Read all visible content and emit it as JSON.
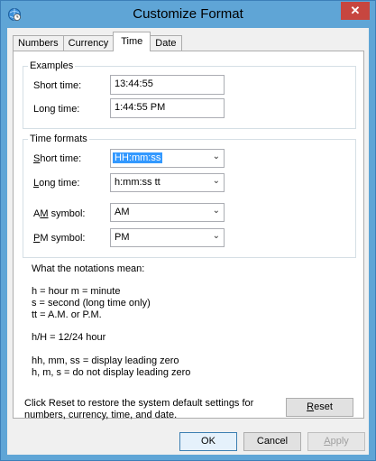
{
  "window": {
    "title": "Customize Format",
    "close_glyph": "✕"
  },
  "tabs": [
    {
      "label": "Numbers",
      "active": false
    },
    {
      "label": "Currency",
      "active": false
    },
    {
      "label": "Time",
      "active": true
    },
    {
      "label": "Date",
      "active": false
    }
  ],
  "examples": {
    "legend": "Examples",
    "short_label": "Short time:",
    "short_value": "13:44:55",
    "long_label": "Long time:",
    "long_value": "1:44:55 PM"
  },
  "formats": {
    "legend": "Time formats",
    "short_label_ul": "S",
    "short_label_rest": "hort time:",
    "short_value": "HH:mm:ss",
    "long_label_ul": "L",
    "long_label_rest": "ong time:",
    "long_value": "h:mm:ss tt",
    "am_label_pre": "A",
    "am_label_ul": "M",
    "am_label_rest": " symbol:",
    "am_value": "AM",
    "pm_label_ul": "P",
    "pm_label_rest": "M symbol:",
    "pm_value": "PM"
  },
  "notations": {
    "title": "What the notations mean:",
    "line1": "h = hour   m = minute",
    "line2": "s = second (long time only)",
    "line3": "tt = A.M. or P.M.",
    "line4": "h/H = 12/24 hour",
    "line5": "hh, mm, ss = display leading zero",
    "line6": "h, m, s = do not display leading zero"
  },
  "reset": {
    "text1": "Click Reset to restore the system default settings for",
    "text2": "numbers, currency, time, and date.",
    "button_ul": "R",
    "button_rest": "eset"
  },
  "footer": {
    "ok": "OK",
    "cancel": "Cancel",
    "apply_ul": "A",
    "apply_rest": "pply"
  },
  "icons": {
    "dropdown": "⌄"
  },
  "colors": {
    "titlebar": "#5fa5d6",
    "close": "#c7463f",
    "selection": "#3399ff"
  }
}
